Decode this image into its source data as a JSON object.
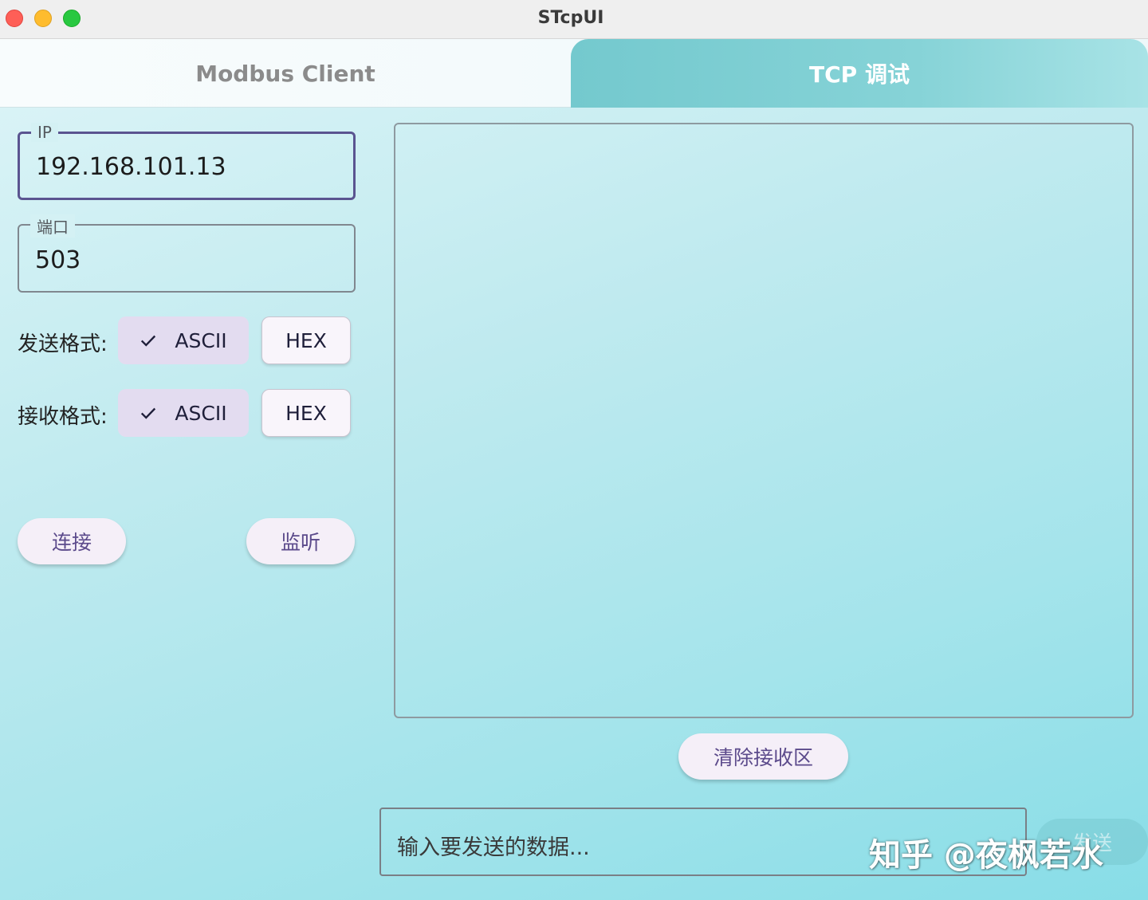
{
  "window": {
    "title": "STcpUI"
  },
  "tabs": [
    {
      "label": "Modbus Client",
      "active": false
    },
    {
      "label": "TCP 调试",
      "active": true
    }
  ],
  "connection": {
    "ip": {
      "label": "IP",
      "value": "192.168.101.13"
    },
    "port": {
      "label": "端口",
      "value": "503"
    }
  },
  "send_format": {
    "label": "发送格式:",
    "options": [
      {
        "label": "ASCII",
        "selected": true
      },
      {
        "label": "HEX",
        "selected": false
      }
    ]
  },
  "receive_format": {
    "label": "接收格式:",
    "options": [
      {
        "label": "ASCII",
        "selected": true
      },
      {
        "label": "HEX",
        "selected": false
      }
    ]
  },
  "actions": {
    "connect_label": "连接",
    "listen_label": "监听",
    "clear_label": "清除接收区"
  },
  "receive_area": {
    "content": ""
  },
  "send": {
    "placeholder": "输入要发送的数据...",
    "button_label": "发送"
  },
  "watermark": "知乎 @夜枫若水",
  "colors": {
    "accent": "#74c9ce",
    "chip_selected": "#e3dcf0",
    "pill_text": "#5b4a8b"
  },
  "icons": {
    "chip_selected": "check-icon"
  }
}
